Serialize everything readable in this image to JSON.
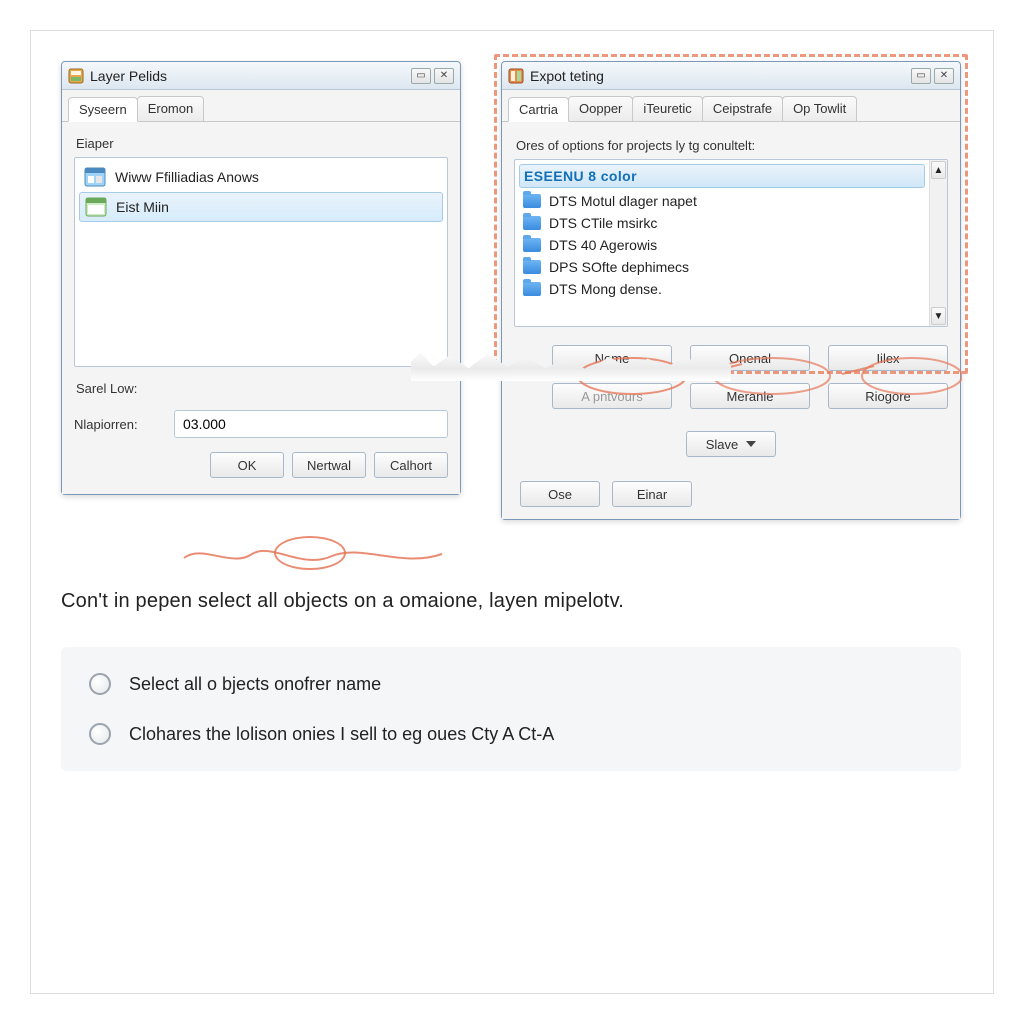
{
  "dialog1": {
    "title": "Layer Pelids",
    "tabs": [
      "Syseern",
      "Eromon"
    ],
    "section": "Eiaper",
    "items": [
      {
        "label": "Wiww Ffilliadias Anows",
        "icon": "window"
      },
      {
        "label": "Eist Miin",
        "icon": "panel"
      }
    ],
    "savel_low": "Sarel Low:",
    "field_label": "Nlapiorren:",
    "field_value": "03.000",
    "buttons": [
      "OK",
      "Nertwal",
      "Calhort"
    ]
  },
  "dialog2": {
    "title": "Expot teting",
    "tabs": [
      "Cartria",
      "Oopper",
      "iTeuretic",
      "Ceipstrafe",
      "Op Towlit"
    ],
    "desc": "Ores of options for projects ly tg conultelt:",
    "header_item": "ESEENU 8 color",
    "options": [
      "DTS Motul dlager napet",
      "DTS CTile msirkc",
      "DTS 40 Agerowis",
      "DPS SOfte dephimecs",
      "DTS Mong dense."
    ],
    "grid_buttons": [
      "Nome",
      "Onenal",
      "Iilex",
      "A pntvours",
      "Meranle",
      "Riogore"
    ],
    "save_label": "Slave",
    "close_buttons": [
      "Ose",
      "Einar"
    ]
  },
  "instruction": "Con't in pepen select all objects on a omaione, layen mipelotv.",
  "choices": [
    "Select all o bjects onofrer name",
    "Clohares the lolison onies I sell to eg oues  Cty A  Ct-A"
  ]
}
